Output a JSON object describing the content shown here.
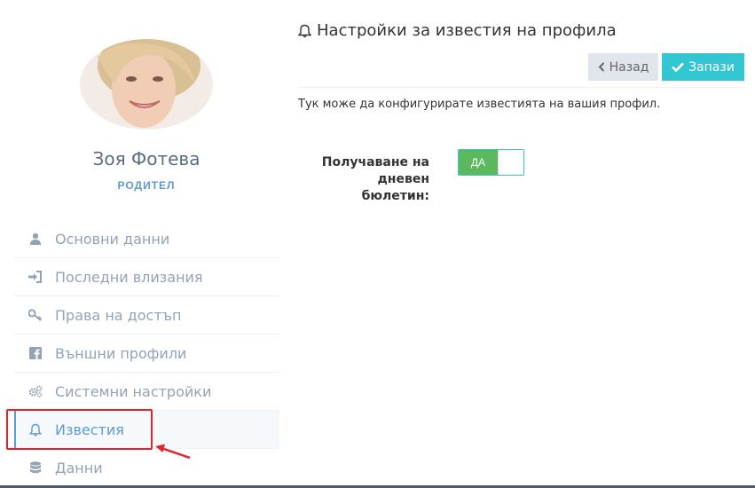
{
  "user": {
    "name": "Зоя Фотева",
    "role": "РОДИТЕЛ"
  },
  "sidebar": {
    "items": [
      {
        "label": "Основни данни",
        "icon": "user-icon"
      },
      {
        "label": "Последни влизания",
        "icon": "sign-in-icon"
      },
      {
        "label": "Права на достъп",
        "icon": "key-icon"
      },
      {
        "label": "Външни профили",
        "icon": "facebook-icon"
      },
      {
        "label": "Системни настройки",
        "icon": "cogs-icon"
      },
      {
        "label": "Известия",
        "icon": "bell-icon",
        "active": true
      },
      {
        "label": "Данни",
        "icon": "database-icon"
      }
    ]
  },
  "main": {
    "title": "Настройки за известия на профила",
    "back_label": "Назад",
    "save_label": "Запази",
    "description": "Тук може да конфигурирате известията на вашия профил.",
    "field_label_line1": "Получаване на",
    "field_label_line2": "дневен бюлетин:",
    "toggle_label": "ДА",
    "toggle_on": true
  },
  "colors": {
    "accent": "#5c9bd1",
    "save": "#32c5d2",
    "toggle_on": "#5cb85c",
    "highlight": "#e0242d"
  }
}
